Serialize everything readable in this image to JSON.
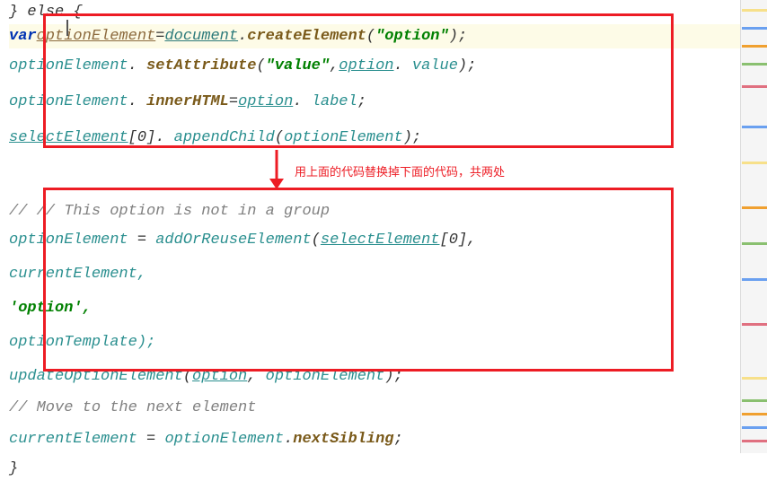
{
  "annotation": "用上面的代码替换掉下面的代码，共两处",
  "code": {
    "l0": "} else {",
    "l1_var": "var",
    "l1_ovar": "optionElement",
    "l1_eq": "=",
    "l1_doc": "document",
    "l1_dot": ".",
    "l1_create": "createElement",
    "l1_open": "(",
    "l1_str": "\"option\"",
    "l1_close": ");",
    "l2_oe": "optionElement",
    "l2_set": "setAttribute",
    "l2_open": "(",
    "l2_str": "\"value\"",
    "l2_comma": ",",
    "l2_opt": "option",
    "l2_val": "value",
    "l2_close": ");",
    "l3_oe": "optionElement",
    "l3_inner": "innerHTML",
    "l3_eq": "=",
    "l3_opt": "option",
    "l3_label": "label",
    "l3_semi": ";",
    "l4_sel": "selectElement",
    "l4_idx": "[0]",
    "l4_append": "appendChild",
    "l4_open": "(",
    "l4_arg": "optionElement",
    "l4_close": ");",
    "l5_comment": "// // This option is not in a group",
    "l6_oe": "optionElement",
    "l6_eq": " = ",
    "l6_fn": "addOrReuseElement",
    "l6_open": "(",
    "l6_sel": "selectElement",
    "l6_idx": "[0]",
    "l6_comma": ",",
    "l7": "currentElement,",
    "l8_open": "'",
    "l8_opt": "option",
    "l8_close": "',",
    "l9": "optionTemplate);",
    "l10_fn": "updateOptionElement",
    "l10_open": "(",
    "l10_opt": "option",
    "l10_comma": ", ",
    "l10_oe": "optionElement",
    "l10_close": ");",
    "l11_comment": "// Move to the next element",
    "l12_cur": "currentElement",
    "l12_eq": " = ",
    "l12_oe": "optionElement",
    "l12_dot": ".",
    "l12_next": "nextSibling",
    "l12_semi": ";",
    "l13": "}"
  },
  "colors": {
    "red": "#ed1c24",
    "keyword": "#0033b3",
    "string": "#008000",
    "identifier": "#2a8f8f",
    "method": "#7a5a1a"
  }
}
